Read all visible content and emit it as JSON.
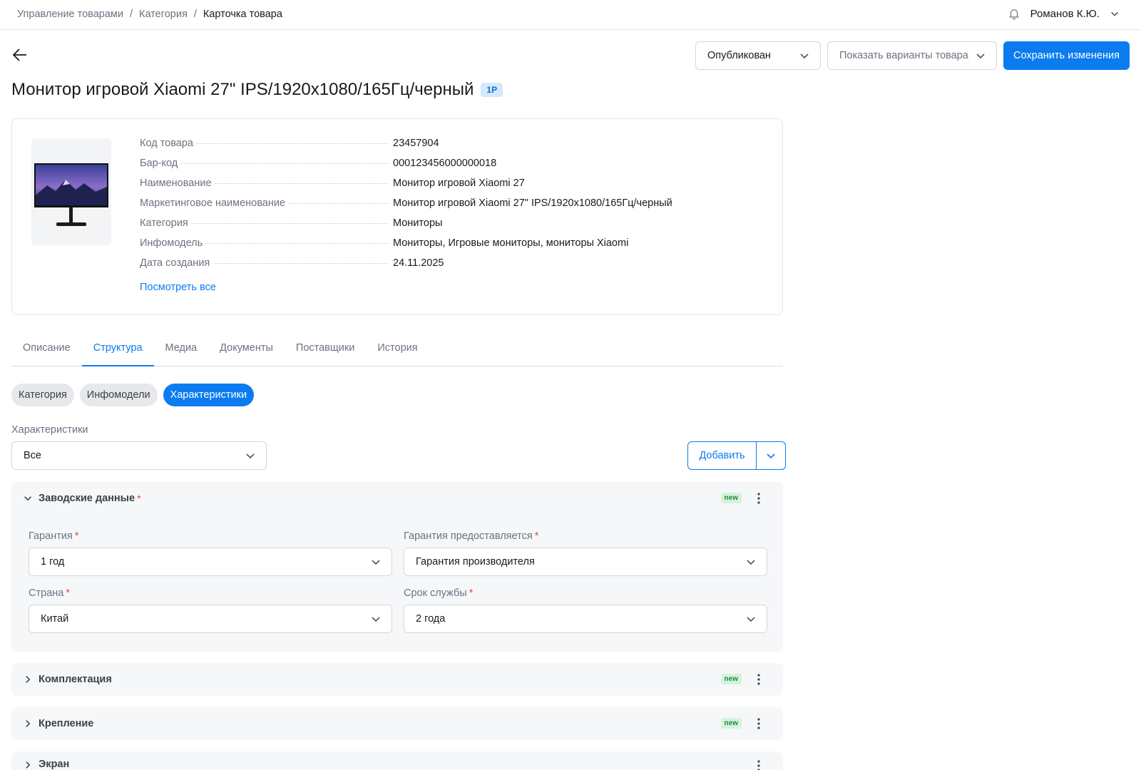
{
  "breadcrumb": [
    "Управление товарами",
    "Категория",
    "Карточка товара"
  ],
  "user": {
    "name": "Романов К.Ю."
  },
  "toolbar": {
    "status_value": "Опубликован",
    "variants_label": "Показать варианты товара",
    "save_label": "Сохранить изменения"
  },
  "product": {
    "title": "Монитор игровой Xiaomi 27\" IPS/1920x1080/165Гц/черный",
    "badge": "1P"
  },
  "info": [
    {
      "key": "Код товара",
      "value": "23457904"
    },
    {
      "key": "Бар-код",
      "value": "000123456000000018"
    },
    {
      "key": "Наименование",
      "value": "Монитор игровой Xiaomi 27"
    },
    {
      "key": "Маркетинговое наименование",
      "value": "Монитор игровой Xiaomi 27\" IPS/1920x1080/165Гц/черный"
    },
    {
      "key": "Категория",
      "value": "Мониторы"
    },
    {
      "key": "Инфомодель",
      "value": "Мониторы, Игровые мониторы, мониторы Xiaomi"
    },
    {
      "key": "Дата создания",
      "value": "24.11.2025"
    }
  ],
  "view_all_label": "Посмотреть все",
  "tabs": [
    "Описание",
    "Структура",
    "Медиа",
    "Документы",
    "Поставщики",
    "История"
  ],
  "active_tab": "Структура",
  "pills": [
    "Категория",
    "Инфомодели",
    "Характеристики"
  ],
  "active_pill": "Характеристики",
  "filter": {
    "label": "Характеристики",
    "value": "Все"
  },
  "add_label": "Добавить",
  "sections": [
    {
      "title": "Заводские данные",
      "badge": "new",
      "fields": [
        {
          "label": "Гарантия",
          "value": "1 год"
        },
        {
          "label": "Гарантия предоставляется",
          "value": "Гарантия производителя"
        },
        {
          "label": "Страна",
          "value": "Китай"
        },
        {
          "label": "Срок службы",
          "value": "2 года"
        }
      ]
    },
    {
      "title": "Комплектация",
      "badge": "new"
    },
    {
      "title": "Крепление",
      "badge": "new"
    },
    {
      "title": "Экран"
    }
  ],
  "required_mark": "*",
  "colors": {
    "accent": "#0a7cf0",
    "required": "#e5484d",
    "new_badge_bg": "#d6f2dc",
    "new_badge_text": "#1f8a3a"
  }
}
